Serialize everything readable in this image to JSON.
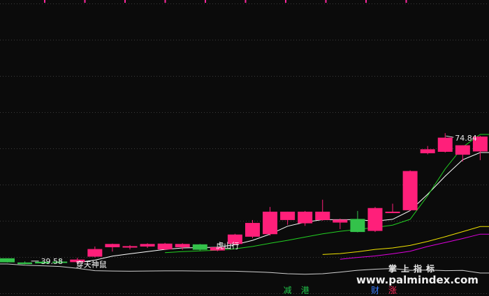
{
  "chart_data": {
    "type": "candlestick",
    "ylim": [
      30,
      77
    ],
    "grid": true,
    "colors": {
      "up": "#ff1f7a",
      "down": "#33c24a",
      "ma_white": "#ffffff",
      "ma_green": "#22d022",
      "ma_yellow": "#f2e400",
      "ma_magenta": "#e000e0",
      "grid": "#3c3c3c",
      "background": "#0b0b0b",
      "top_tick": "#ff2aa0"
    },
    "candles": [
      {
        "open": 40.35,
        "high": 40.35,
        "low": 39.2,
        "close": 39.25
      },
      {
        "open": 39.2,
        "high": 39.5,
        "low": 38.7,
        "close": 38.75
      },
      {
        "open": 39.4,
        "high": 39.6,
        "low": 38.9,
        "close": 38.95
      },
      {
        "open": 39.45,
        "high": 40.2,
        "low": 39.1,
        "close": 39.2
      },
      {
        "open": 39.3,
        "high": 40.5,
        "low": 39.0,
        "close": 40.0
      },
      {
        "open": 40.8,
        "high": 43.6,
        "low": 40.6,
        "close": 42.9
      },
      {
        "open": 43.4,
        "high": 44.4,
        "low": 42.2,
        "close": 44.3
      },
      {
        "open": 43.3,
        "high": 44.0,
        "low": 42.8,
        "close": 43.7
      },
      {
        "open": 43.6,
        "high": 44.5,
        "low": 43.2,
        "close": 44.3
      },
      {
        "open": 42.8,
        "high": 44.6,
        "low": 42.6,
        "close": 44.4
      },
      {
        "open": 43.4,
        "high": 44.5,
        "low": 42.7,
        "close": 44.3
      },
      {
        "open": 44.2,
        "high": 44.3,
        "low": 42.5,
        "close": 42.7
      },
      {
        "open": 42.5,
        "high": 43.6,
        "low": 42.3,
        "close": 43.4
      },
      {
        "open": 44.3,
        "high": 47.1,
        "low": 44.1,
        "close": 46.9
      },
      {
        "open": 46.3,
        "high": 50.9,
        "low": 45.9,
        "close": 50.1
      },
      {
        "open": 47.0,
        "high": 54.5,
        "low": 46.6,
        "close": 53.2
      },
      {
        "open": 50.9,
        "high": 53.2,
        "low": 49.6,
        "close": 53.2
      },
      {
        "open": 50.0,
        "high": 53.4,
        "low": 49.3,
        "close": 53.2
      },
      {
        "open": 50.9,
        "high": 56.5,
        "low": 50.7,
        "close": 53.2
      },
      {
        "open": 50.2,
        "high": 51.3,
        "low": 48.4,
        "close": 51.0
      },
      {
        "open": 51.2,
        "high": 53.4,
        "low": 47.5,
        "close": 47.6
      },
      {
        "open": 47.9,
        "high": 54.5,
        "low": 47.6,
        "close": 54.2
      },
      {
        "open": 53.0,
        "high": 55.4,
        "low": 52.9,
        "close": 53.2
      },
      {
        "open": 53.6,
        "high": 64.6,
        "low": 53.4,
        "close": 64.4
      },
      {
        "open": 69.3,
        "high": 71.3,
        "low": 69.0,
        "close": 70.4
      },
      {
        "open": 69.7,
        "high": 74.84,
        "low": 69.5,
        "close": 73.6
      },
      {
        "open": 68.9,
        "high": 71.5,
        "low": 67.0,
        "close": 71.5
      },
      {
        "open": 69.8,
        "high": 74.1,
        "low": 67.4,
        "close": 73.9
      }
    ],
    "ma_lines": [
      {
        "color": "#ffffff",
        "values": [
          null,
          null,
          null,
          null,
          39.2,
          39.85,
          40.95,
          41.6,
          42.2,
          42.8,
          43.2,
          43.3,
          43.4,
          44.1,
          45.3,
          47.0,
          49.2,
          50.3,
          51.0,
          51.0,
          51.0,
          50.6,
          51.1,
          53.5,
          58.0,
          63.0,
          67.5,
          69.5
        ]
      },
      {
        "color": "#22d022",
        "values": [
          null,
          null,
          null,
          null,
          null,
          null,
          null,
          null,
          null,
          41.9,
          42.2,
          42.4,
          42.6,
          42.95,
          43.6,
          44.5,
          45.3,
          46.2,
          47.1,
          47.8,
          48.3,
          48.85,
          49.5,
          51.1,
          57.6,
          65.0,
          71.0,
          74.5
        ]
      },
      {
        "color": "#f2e400",
        "values": [
          null,
          null,
          null,
          null,
          null,
          null,
          null,
          null,
          null,
          null,
          null,
          null,
          null,
          null,
          null,
          null,
          null,
          null,
          41.4,
          41.65,
          42.15,
          42.8,
          43.2,
          43.9,
          45.0,
          46.3,
          47.7,
          49.1
        ]
      },
      {
        "color": "#e000e0",
        "values": [
          null,
          null,
          null,
          null,
          null,
          null,
          null,
          null,
          null,
          null,
          null,
          null,
          null,
          null,
          null,
          null,
          null,
          null,
          null,
          40.1,
          40.6,
          41.0,
          41.6,
          42.3,
          43.6,
          44.7,
          45.8,
          47.0
        ]
      }
    ],
    "indicator_line": {
      "color": "#cfcfcf",
      "values": [
        38.8,
        38.45,
        38.3,
        38.1,
        37.6,
        36.95,
        36.85,
        36.8,
        36.85,
        36.9,
        36.9,
        36.85,
        36.85,
        36.8,
        36.65,
        36.45,
        36.1,
        35.95,
        36.1,
        36.55,
        37.05,
        37.35,
        37.55,
        37.05,
        37.1,
        36.95,
        37.0,
        36.3
      ]
    },
    "annotations": [
      {
        "text": "穿天神鼠",
        "index": 4,
        "y": 38.7
      },
      {
        "text": "虎山行",
        "index": 12,
        "y": 43.9
      }
    ],
    "price_labels": {
      "high": {
        "text": "74.84",
        "index": 25
      },
      "low": {
        "text": "39.58",
        "index": 1
      }
    },
    "top_ticks_count": 10
  },
  "watermark": {
    "line1": "掌上指标",
    "line2": "www.palmindex.com"
  },
  "bottom_tags": [
    {
      "text": "减",
      "color": "#21c44a",
      "index": 16
    },
    {
      "text": "港",
      "color": "#21c44a",
      "index": 17
    },
    {
      "text": "财",
      "color": "#3a7cff",
      "index": 21
    },
    {
      "text": "涨",
      "color": "#ff2a5a",
      "index": 22
    }
  ]
}
